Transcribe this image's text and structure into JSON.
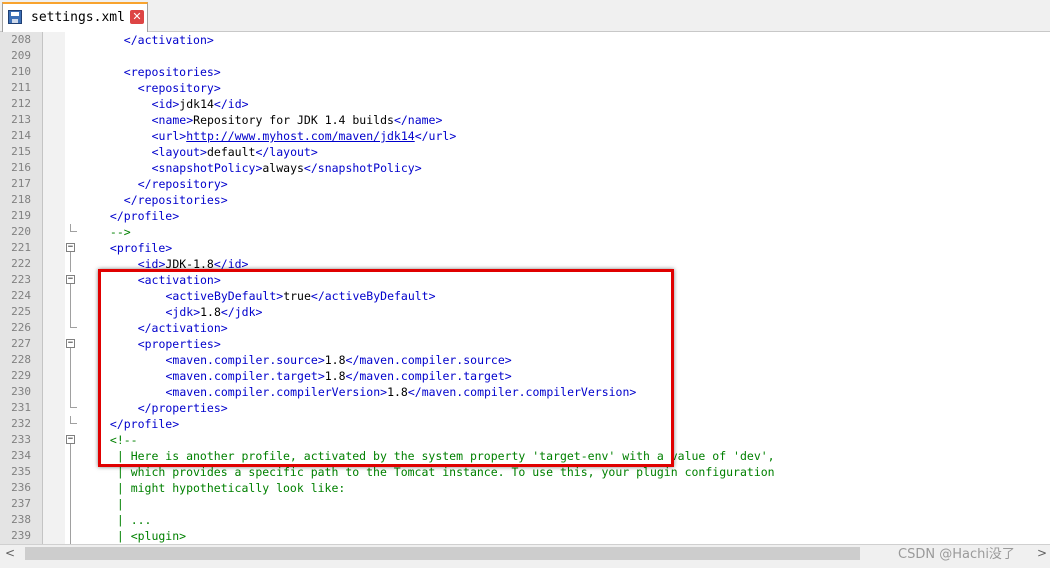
{
  "tab": {
    "filename": "settings.xml",
    "close_glyph": "✕",
    "icon": "save-disk-icon"
  },
  "lines": [
    {
      "n": "208",
      "ind": 4,
      "t": [
        [
          "tag",
          "</activation>"
        ]
      ]
    },
    {
      "n": "209",
      "ind": 0,
      "t": []
    },
    {
      "n": "210",
      "ind": 4,
      "t": [
        [
          "tag",
          "<repositories>"
        ]
      ]
    },
    {
      "n": "211",
      "ind": 6,
      "t": [
        [
          "tag",
          "<repository>"
        ]
      ]
    },
    {
      "n": "212",
      "ind": 8,
      "t": [
        [
          "tag",
          "<id>"
        ],
        [
          "txt",
          "jdk14"
        ],
        [
          "tag",
          "</id>"
        ]
      ]
    },
    {
      "n": "213",
      "ind": 8,
      "t": [
        [
          "tag",
          "<name>"
        ],
        [
          "txt",
          "Repository for JDK 1.4 builds"
        ],
        [
          "tag",
          "</name>"
        ]
      ]
    },
    {
      "n": "214",
      "ind": 8,
      "t": [
        [
          "tag",
          "<url>"
        ],
        [
          "url",
          "http://www.myhost.com/maven/jdk14"
        ],
        [
          "tag",
          "</url>"
        ]
      ]
    },
    {
      "n": "215",
      "ind": 8,
      "t": [
        [
          "tag",
          "<layout>"
        ],
        [
          "txt",
          "default"
        ],
        [
          "tag",
          "</layout>"
        ]
      ]
    },
    {
      "n": "216",
      "ind": 8,
      "t": [
        [
          "tag",
          "<snapshotPolicy>"
        ],
        [
          "txt",
          "always"
        ],
        [
          "tag",
          "</snapshotPolicy>"
        ]
      ]
    },
    {
      "n": "217",
      "ind": 6,
      "t": [
        [
          "tag",
          "</repository>"
        ]
      ]
    },
    {
      "n": "218",
      "ind": 4,
      "t": [
        [
          "tag",
          "</repositories>"
        ]
      ]
    },
    {
      "n": "219",
      "ind": 2,
      "t": [
        [
          "tag",
          "</profile>"
        ]
      ]
    },
    {
      "n": "220",
      "ind": 2,
      "t": [
        [
          "cmt",
          "-->"
        ]
      ],
      "m": "end"
    },
    {
      "n": "221",
      "ind": 2,
      "t": [
        [
          "tag",
          "<profile>"
        ]
      ],
      "m": "fold"
    },
    {
      "n": "222",
      "ind": 6,
      "t": [
        [
          "tag",
          "<id>"
        ],
        [
          "txt",
          "JDK-1.8"
        ],
        [
          "tag",
          "</id>"
        ]
      ],
      "m": "line"
    },
    {
      "n": "223",
      "ind": 6,
      "t": [
        [
          "tag",
          "<activation>"
        ]
      ],
      "m": "fold"
    },
    {
      "n": "224",
      "ind": 10,
      "t": [
        [
          "tag",
          "<activeByDefault>"
        ],
        [
          "txt",
          "true"
        ],
        [
          "tag",
          "</activeByDefault>"
        ]
      ],
      "m": "line"
    },
    {
      "n": "225",
      "ind": 10,
      "t": [
        [
          "tag",
          "<jdk>"
        ],
        [
          "txt",
          "1.8"
        ],
        [
          "tag",
          "</jdk>"
        ]
      ],
      "m": "line"
    },
    {
      "n": "226",
      "ind": 6,
      "t": [
        [
          "tag",
          "</activation>"
        ]
      ],
      "m": "end"
    },
    {
      "n": "227",
      "ind": 6,
      "t": [
        [
          "tag",
          "<properties>"
        ]
      ],
      "m": "fold"
    },
    {
      "n": "228",
      "ind": 10,
      "t": [
        [
          "tag",
          "<maven.compiler.source>"
        ],
        [
          "txt",
          "1.8"
        ],
        [
          "tag",
          "</maven.compiler.source>"
        ]
      ],
      "m": "line"
    },
    {
      "n": "229",
      "ind": 10,
      "t": [
        [
          "tag",
          "<maven.compiler.target>"
        ],
        [
          "txt",
          "1.8"
        ],
        [
          "tag",
          "</maven.compiler.target>"
        ]
      ],
      "m": "line"
    },
    {
      "n": "230",
      "ind": 10,
      "t": [
        [
          "tag",
          "<maven.compiler.compilerVersion>"
        ],
        [
          "txt",
          "1.8"
        ],
        [
          "tag",
          "</maven.compiler.compilerVersion>"
        ]
      ],
      "m": "line"
    },
    {
      "n": "231",
      "ind": 6,
      "t": [
        [
          "tag",
          "</properties>"
        ]
      ],
      "m": "end"
    },
    {
      "n": "232",
      "ind": 2,
      "t": [
        [
          "tag",
          "</profile>"
        ]
      ],
      "m": "end"
    },
    {
      "n": "233",
      "ind": 2,
      "t": [
        [
          "cmt",
          "<!--"
        ]
      ],
      "m": "fold"
    },
    {
      "n": "234",
      "ind": 3,
      "t": [
        [
          "cmt",
          "| Here is another profile, activated by the system property 'target-env' with a value of 'dev',"
        ]
      ],
      "m": "line"
    },
    {
      "n": "235",
      "ind": 3,
      "t": [
        [
          "cmt",
          "| which provides a specific path to the Tomcat instance. To use this, your plugin configuration"
        ]
      ],
      "m": "line"
    },
    {
      "n": "236",
      "ind": 3,
      "t": [
        [
          "cmt",
          "| might hypothetically look like:"
        ]
      ],
      "m": "line"
    },
    {
      "n": "237",
      "ind": 3,
      "t": [
        [
          "cmt",
          "|"
        ]
      ],
      "m": "line"
    },
    {
      "n": "238",
      "ind": 3,
      "t": [
        [
          "cmt",
          "| ..."
        ]
      ],
      "m": "line"
    },
    {
      "n": "239",
      "ind": 3,
      "t": [
        [
          "cmt",
          "| <plugin>"
        ]
      ],
      "m": "line"
    }
  ],
  "scrollbar": {
    "left_arrow": "<",
    "right_arrow": ">"
  },
  "watermark": "CSDN @Hachi没了"
}
